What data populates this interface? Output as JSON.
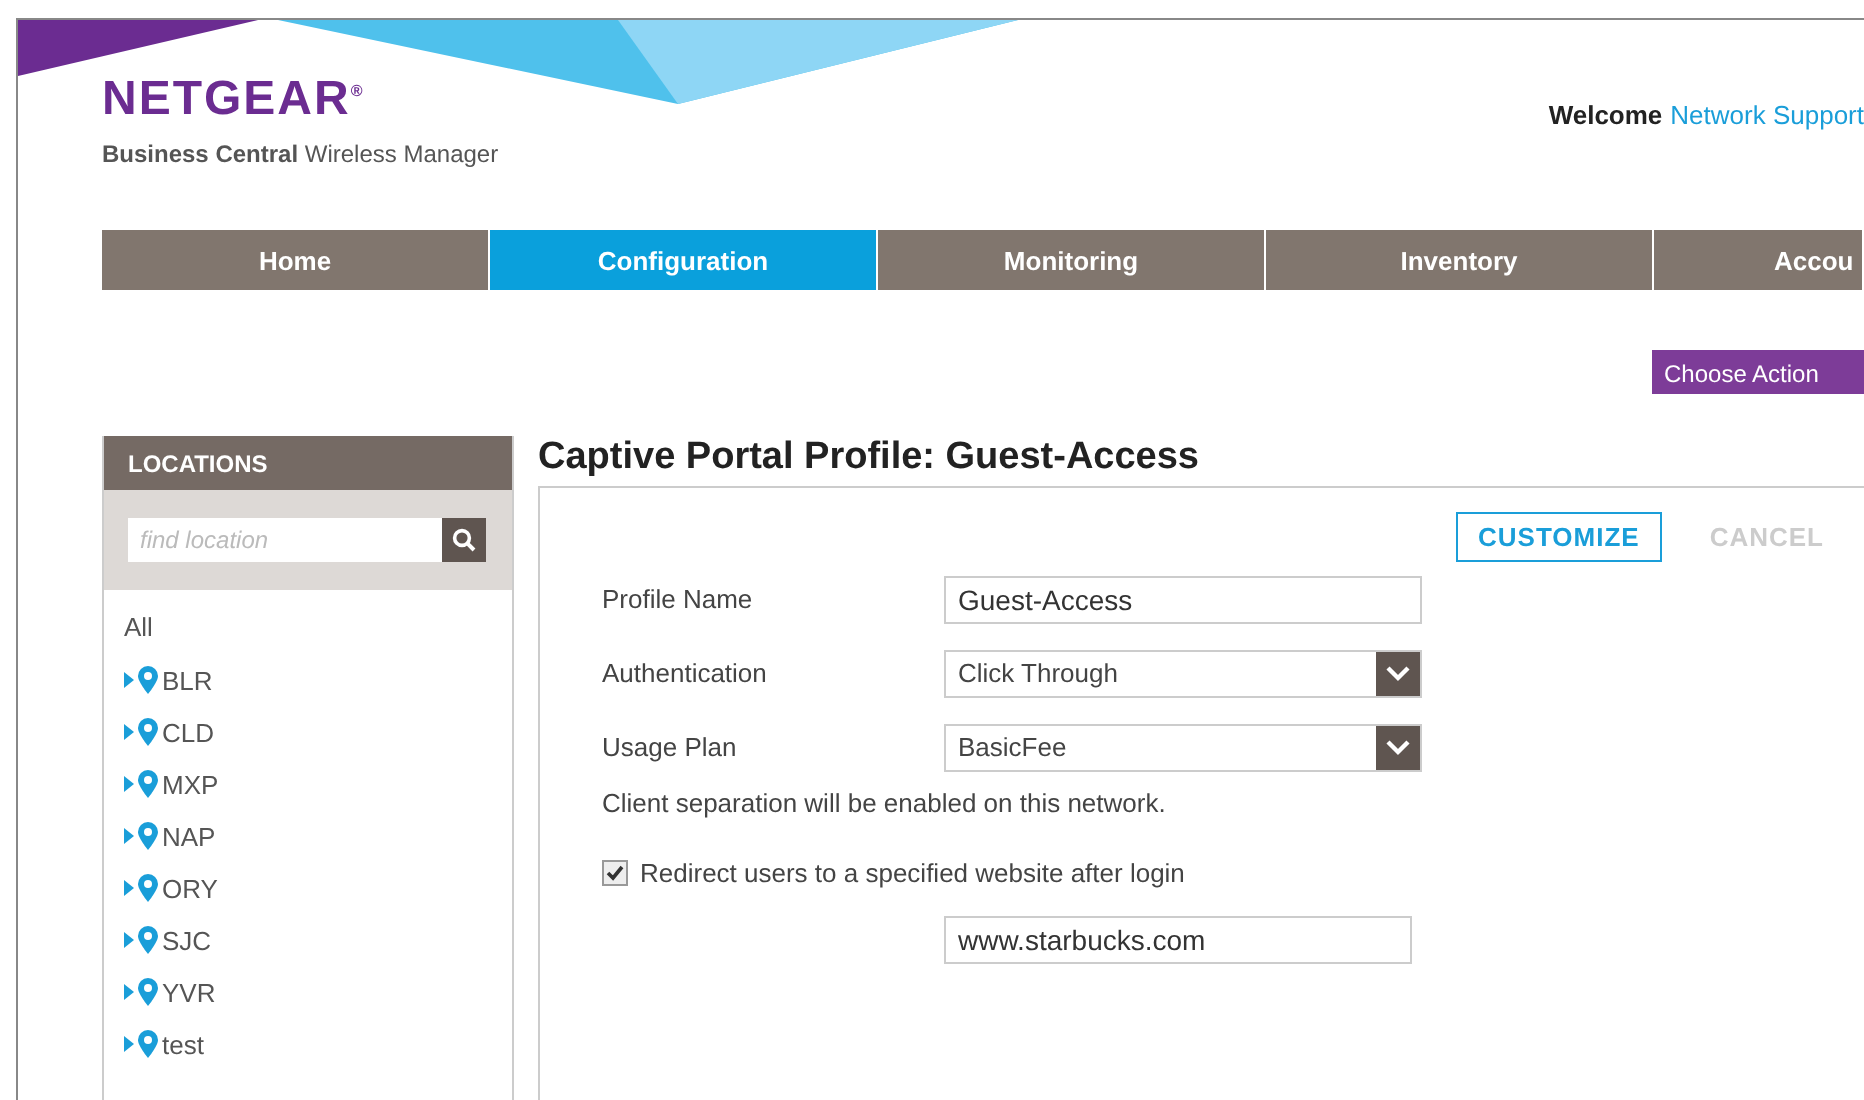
{
  "header": {
    "brand": "NETGEAR",
    "brand_mark": "®",
    "subtitle_bold": "Business Central",
    "subtitle": "Wireless Manager",
    "welcome": "Welcome",
    "user": "Network Support"
  },
  "nav": [
    {
      "label": "Home",
      "selected": false
    },
    {
      "label": "Configuration",
      "selected": true
    },
    {
      "label": "Monitoring",
      "selected": false
    },
    {
      "label": "Inventory",
      "selected": false
    },
    {
      "label": "Accou",
      "selected": false
    }
  ],
  "action_button": "Choose Action",
  "sidebar": {
    "title": "LOCATIONS",
    "search": {
      "placeholder": "find location"
    },
    "all": "All",
    "items": [
      {
        "label": "BLR",
        "expanded": false
      },
      {
        "label": "CLD",
        "expanded": false
      },
      {
        "label": "MXP",
        "expanded": false
      },
      {
        "label": "NAP",
        "expanded": false
      },
      {
        "label": "ORY",
        "expanded": false
      },
      {
        "label": "SJC",
        "expanded": false
      },
      {
        "label": "YVR",
        "expanded": false
      },
      {
        "label": "test",
        "expanded": false
      }
    ]
  },
  "main": {
    "title": "Captive Portal Profile: Guest-Access",
    "buttons": [
      {
        "label": "CUSTOMIZE",
        "disabled": false
      },
      {
        "label": "CANCEL",
        "disabled": true
      }
    ],
    "fields": [
      {
        "kind": "text",
        "label": "Profile Name",
        "value": "Guest-Access"
      },
      {
        "kind": "select",
        "label": "Authentication",
        "value": "Click Through"
      },
      {
        "kind": "select",
        "label": "Usage Plan",
        "value": "BasicFee"
      }
    ],
    "note": "Client separation will be enabled on this network.",
    "redirect": {
      "label": "Redirect users to a specified website after login",
      "checked": true,
      "value": "www.starbucks.com"
    }
  }
}
